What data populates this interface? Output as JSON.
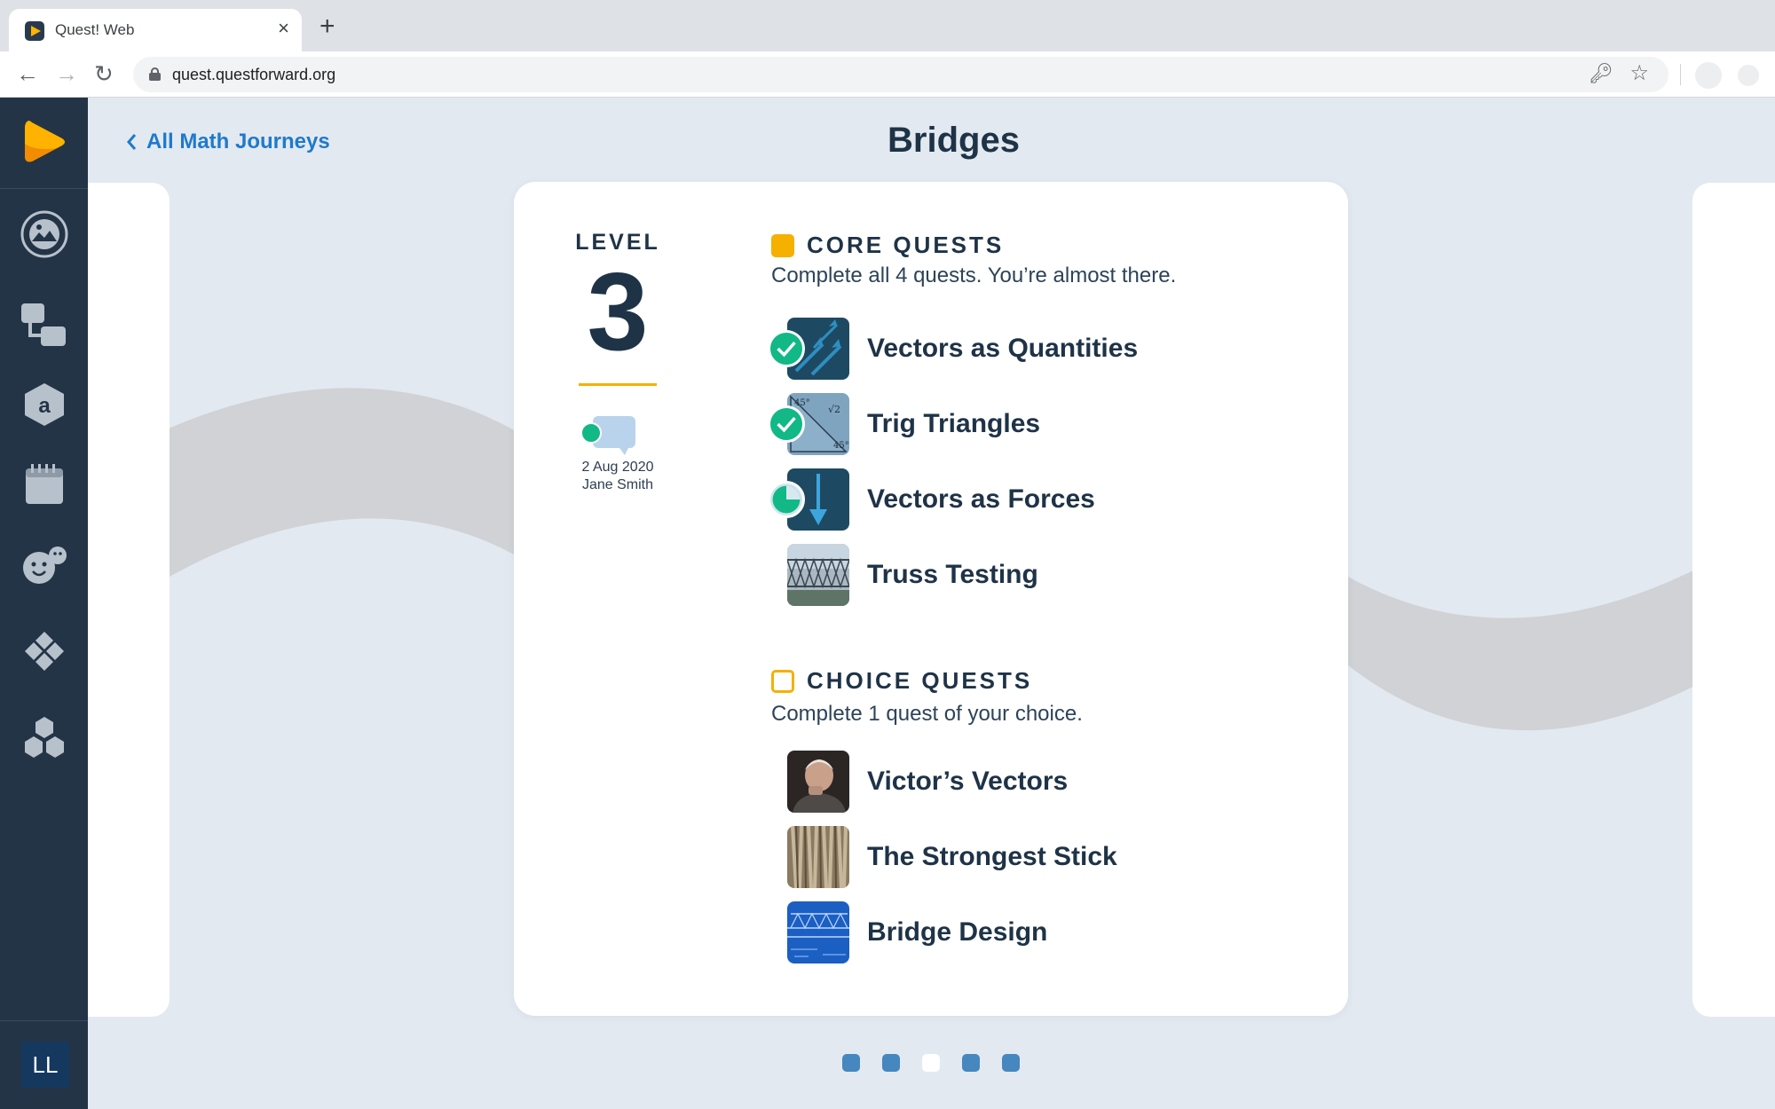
{
  "browser": {
    "tab_title": "Quest! Web",
    "tab_close": "×",
    "new_tab": "+",
    "url": "quest.questforward.org"
  },
  "sidebar": {
    "items": [
      "media-icon",
      "cards-icon",
      "badge-icon",
      "calendar-icon",
      "faces-icon",
      "diamonds-icon",
      "hexagons-icon"
    ],
    "avatar_initials": "LL"
  },
  "header": {
    "back_label": "All Math Journeys",
    "title": "Bridges"
  },
  "level": {
    "label": "LEVEL",
    "number": "3",
    "comment_date": "2 Aug 2020",
    "comment_author": "Jane Smith"
  },
  "core": {
    "title": "CORE QUESTS",
    "subtitle": "Complete all 4 quests. You’re almost there.",
    "quests": [
      {
        "label": "Vectors as Quantities",
        "status": "complete"
      },
      {
        "label": "Trig Triangles",
        "status": "complete"
      },
      {
        "label": "Vectors as Forces",
        "status": "in-progress",
        "progress": 0.25
      },
      {
        "label": "Truss Testing",
        "status": "not-started"
      }
    ]
  },
  "choice": {
    "title": "CHOICE QUESTS",
    "subtitle": "Complete 1 quest of your choice.",
    "quests": [
      {
        "label": "Victor’s Vectors"
      },
      {
        "label": "The Strongest Stick"
      },
      {
        "label": "Bridge Design"
      }
    ]
  },
  "pager": {
    "count": 5,
    "active_index": 2
  },
  "colors": {
    "accent": "#f5b000",
    "link": "#1f7acb",
    "sidebar": "#243447",
    "success": "#12b886",
    "text": "#1f3347"
  }
}
